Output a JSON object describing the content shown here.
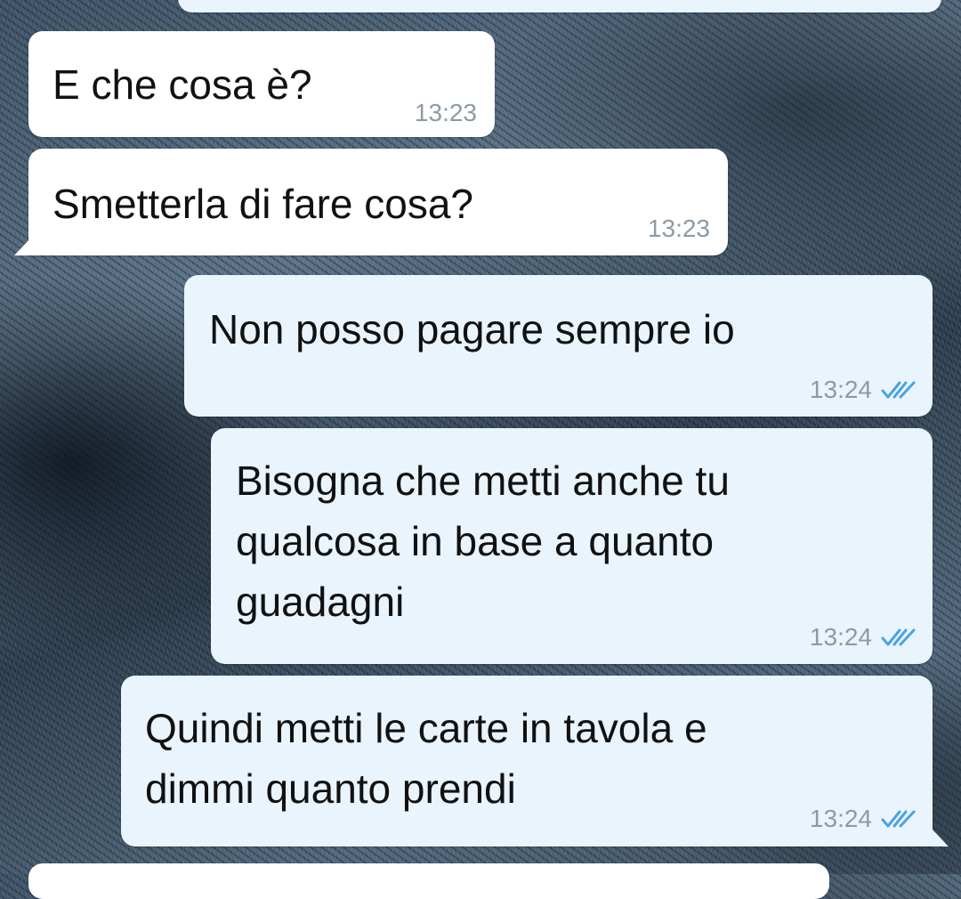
{
  "messages": [
    {
      "direction": "in",
      "text": "E che cosa è?",
      "time": "13:23"
    },
    {
      "direction": "in",
      "text": "Smetterla di fare cosa?",
      "time": "13:23"
    },
    {
      "direction": "out",
      "text": "Non posso pagare sempre io",
      "time": "13:24",
      "status": "read"
    },
    {
      "direction": "out",
      "text": "Bisogna che metti anche tu\nqualcosa in base a quanto\nguadagni",
      "time": "13:24",
      "status": "read"
    },
    {
      "direction": "out",
      "text": "Quindi metti le carte in tavola e\ndimmi quanto prendi",
      "time": "13:24",
      "status": "read"
    }
  ],
  "colors": {
    "incoming_bubble": "#ffffff",
    "outgoing_bubble": "#eaf4fd",
    "read_check": "#4aa3df",
    "timestamp": "#8d9aa5"
  },
  "icons": {
    "read_status": "double-check-icon"
  }
}
